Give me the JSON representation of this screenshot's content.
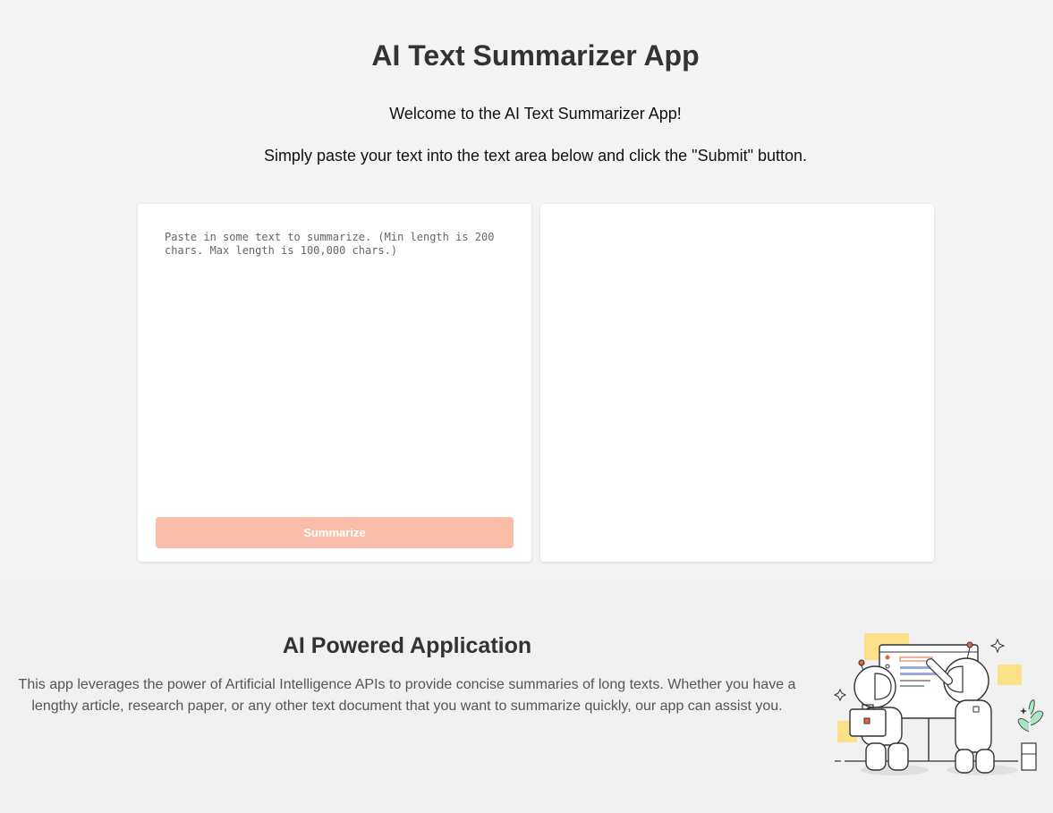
{
  "header": {
    "title": "AI Text Summarizer App",
    "welcome": "Welcome to the AI Text Summarizer App!",
    "instructions": "Simply paste your text into the text area below and click the \"Submit\" button."
  },
  "input_card": {
    "placeholder": "Paste in some text to summarize. (Min length is 200 chars. Max length is 100,000 chars.)",
    "value": "",
    "button_label": "Summarize",
    "button_color": "#f9bdaa"
  },
  "output_card": {
    "summary": ""
  },
  "about": {
    "title": "AI Powered Application",
    "description": "This app leverages the power of Artificial Intelligence APIs to provide concise summaries of long texts. Whether you have a lengthy article, research paper, or any other text document that you want to summarize quickly, our app can assist you.",
    "illustration": "robots-presenting-illustration"
  },
  "colors": {
    "background_top": "#f4f4f4",
    "background_bottom": "#f1f1f1",
    "accent_orange": "#f9bdaa",
    "illustration_yellow": "#fde08a",
    "illustration_red": "#e8643c"
  }
}
